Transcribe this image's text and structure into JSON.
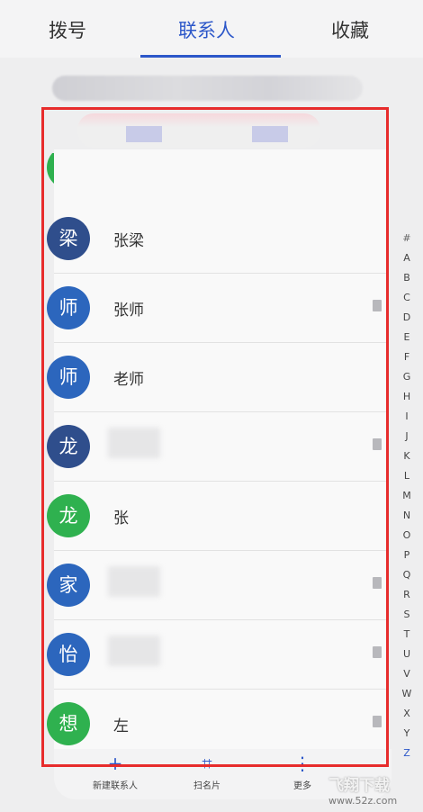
{
  "tabs": [
    {
      "label": "拨号"
    },
    {
      "label": "联系人"
    },
    {
      "label": "收藏"
    }
  ],
  "contacts": [
    {
      "avatar": "梁",
      "name": "张梁",
      "color": "#2f4e8c",
      "sim": false
    },
    {
      "avatar": "师",
      "name": "张师",
      "color": "#2c66bd",
      "sim": true
    },
    {
      "avatar": "师",
      "name": "老师",
      "color": "#2c66bd",
      "sim": false
    },
    {
      "avatar": "龙",
      "name": "",
      "color": "#2f4e8c",
      "sim": true
    },
    {
      "avatar": "龙",
      "name": "张",
      "color": "#2fb14f",
      "sim": false
    },
    {
      "avatar": "家",
      "name": "",
      "color": "#2c66bd",
      "sim": true
    },
    {
      "avatar": "怡",
      "name": "",
      "color": "#2c66bd",
      "sim": true
    },
    {
      "avatar": "想",
      "name": "左",
      "color": "#2fb14f",
      "sim": true
    }
  ],
  "index_letters": [
    "#",
    "A",
    "B",
    "C",
    "D",
    "E",
    "F",
    "G",
    "H",
    "I",
    "J",
    "K",
    "L",
    "M",
    "N",
    "O",
    "P",
    "Q",
    "R",
    "S",
    "T",
    "U",
    "V",
    "W",
    "X",
    "Y",
    "Z"
  ],
  "bottom_actions": [
    {
      "icon": "+",
      "label": "新建联系人"
    },
    {
      "icon": "⌗",
      "label": "扫名片"
    },
    {
      "icon": "⋮",
      "label": "更多"
    }
  ],
  "watermark": {
    "title": "飞翔下载",
    "url": "www.52z.com"
  }
}
